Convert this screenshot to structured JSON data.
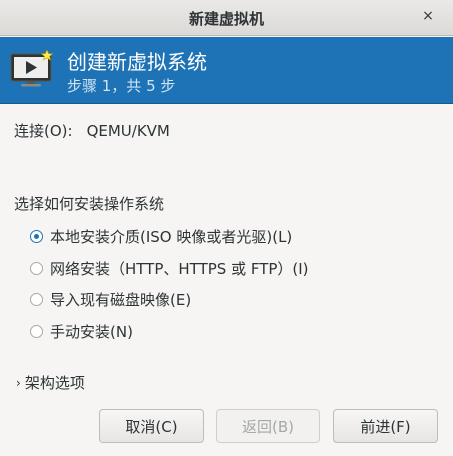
{
  "window": {
    "title": "新建虚拟机",
    "close_glyph": "×"
  },
  "header": {
    "title": "创建新虚拟系统",
    "subtitle": "步骤 1，共 5 步",
    "icon": "monitor-icon",
    "background_color": "#1d73b6"
  },
  "connection": {
    "label": "连接(O):",
    "value": "QEMU/KVM"
  },
  "install_method": {
    "label": "选择如何安装操作系统",
    "options": [
      {
        "label": "本地安装介质(ISO 映像或者光驱)(L)",
        "checked": true
      },
      {
        "label": "网络安装（HTTP、HTTPS 或 FTP）(I)",
        "checked": false
      },
      {
        "label": "导入现有磁盘映像(E)",
        "checked": false
      },
      {
        "label": "手动安装(N)",
        "checked": false
      }
    ]
  },
  "arch_options": {
    "label": "架构选项",
    "glyph": "›"
  },
  "buttons": {
    "cancel": "取消(C)",
    "back": "返回(B)",
    "forward": "前进(F)"
  }
}
